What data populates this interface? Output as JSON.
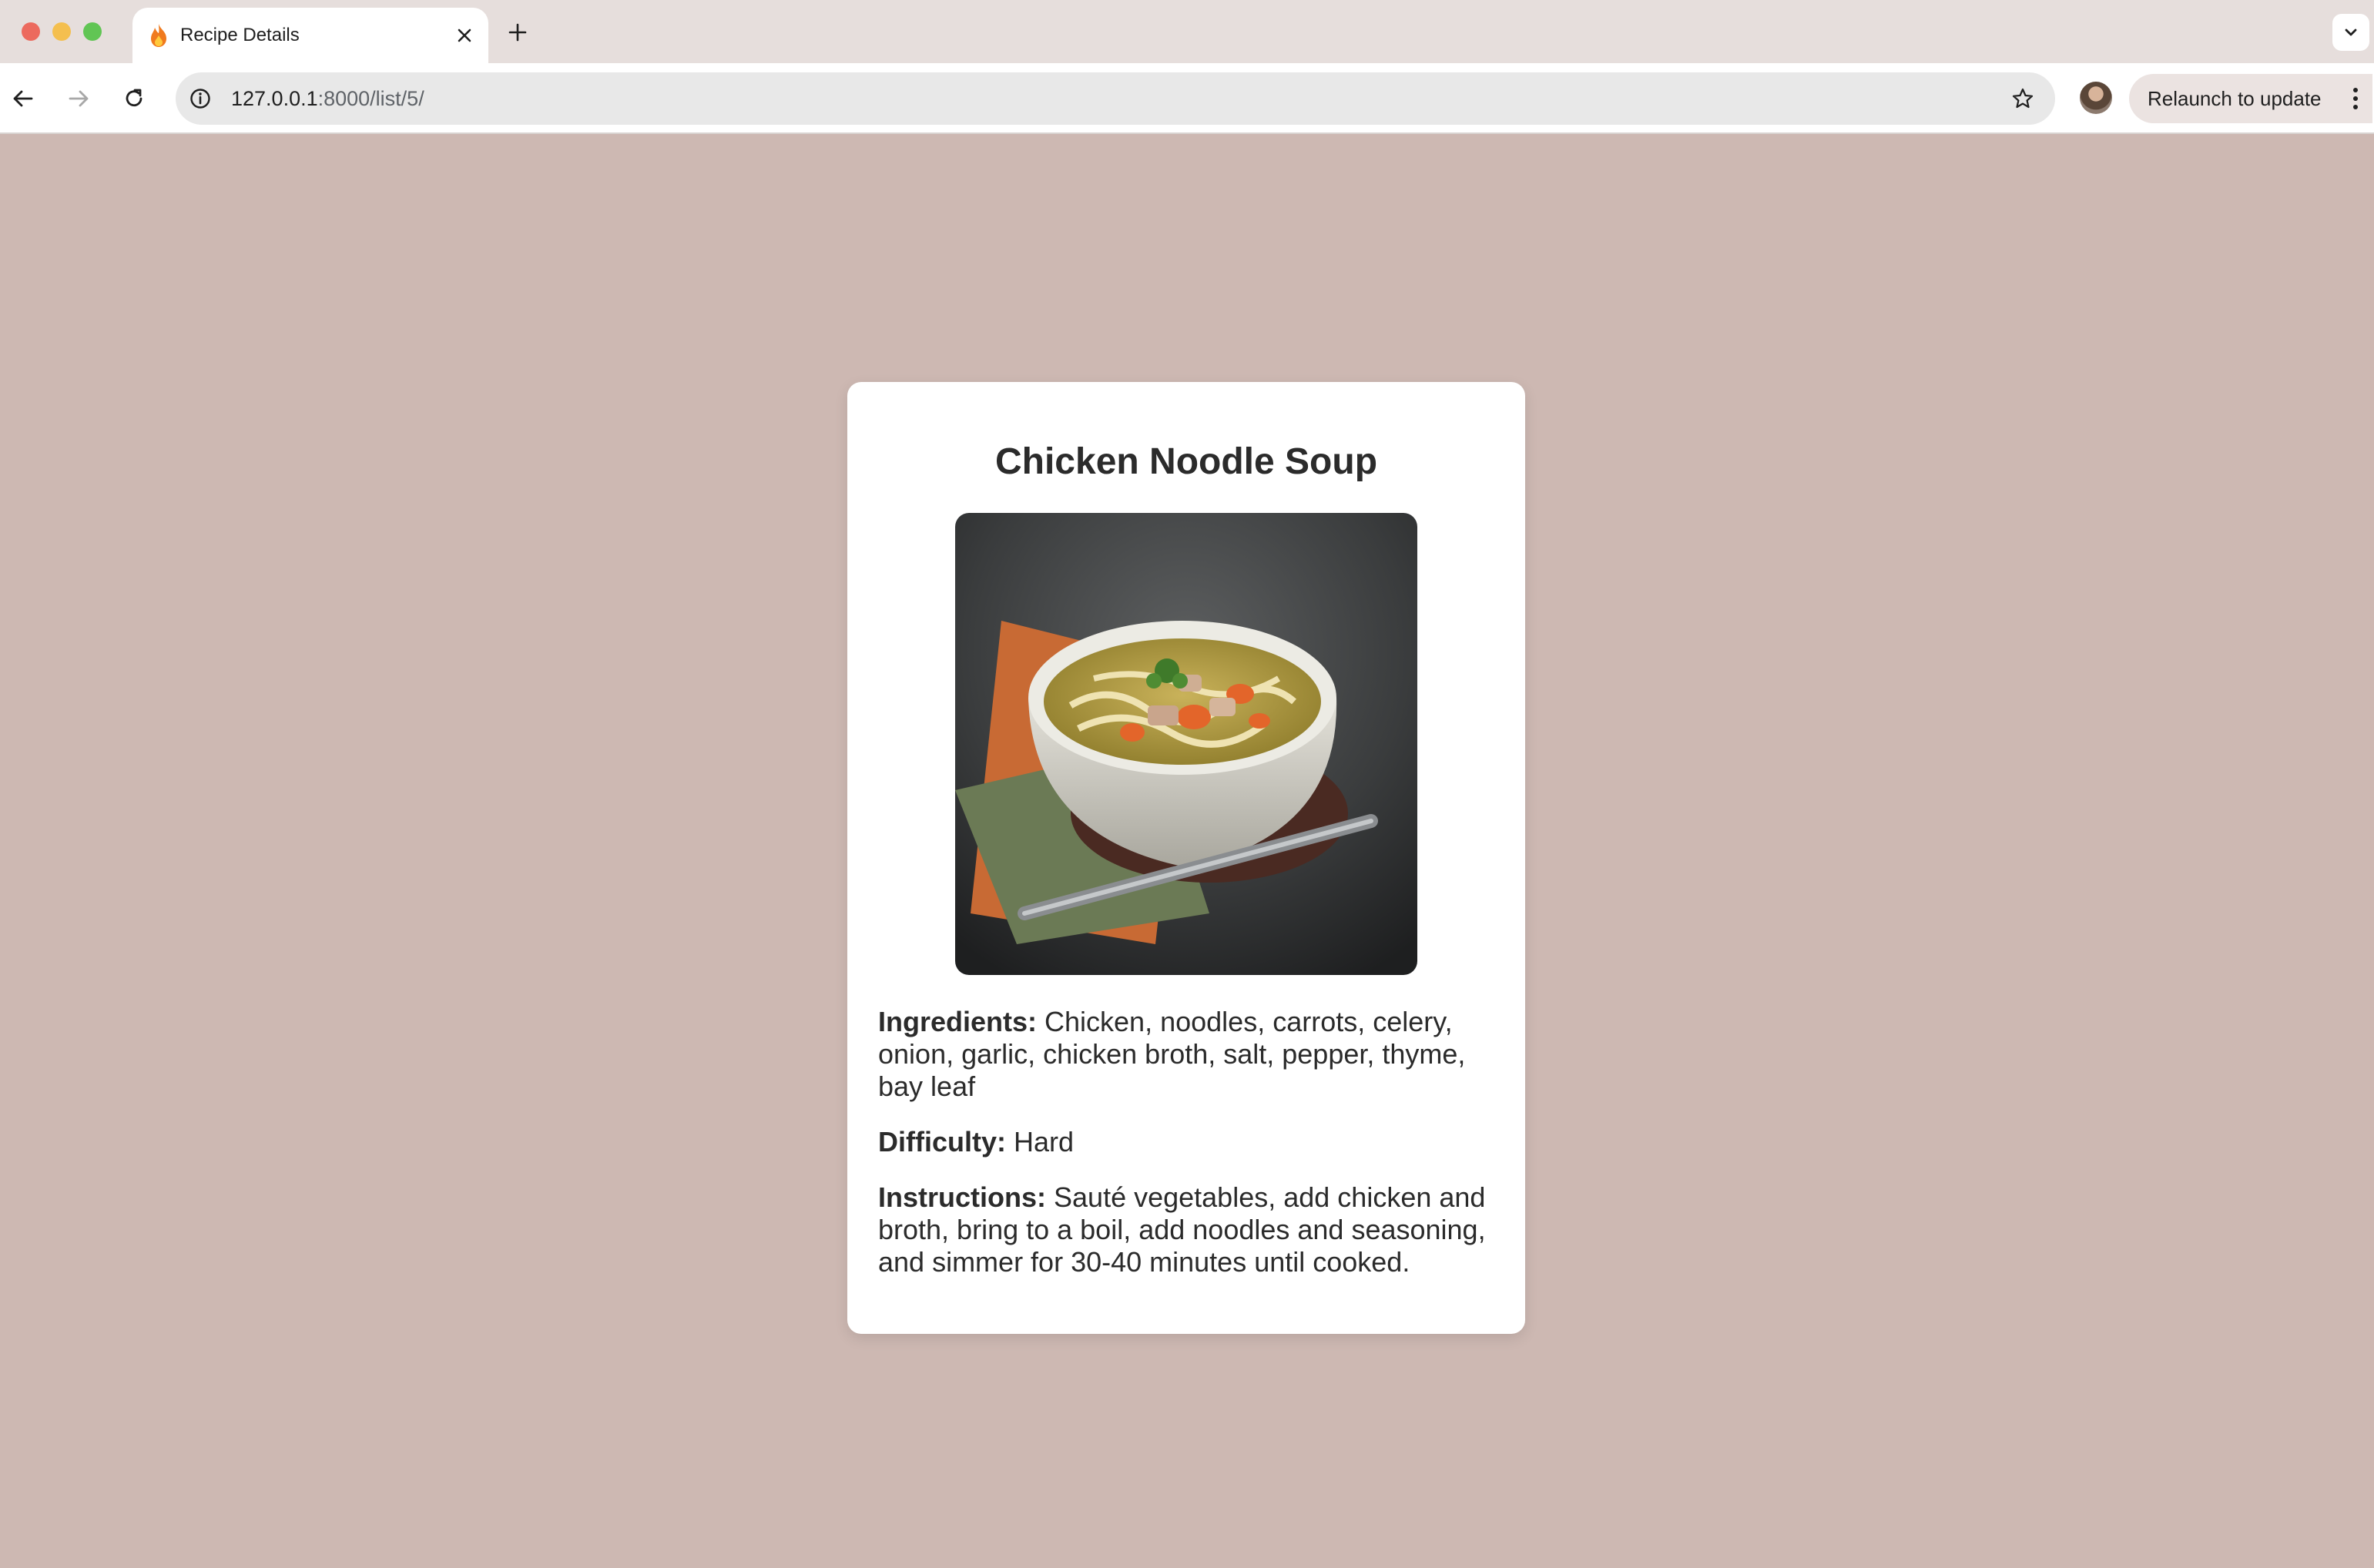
{
  "browser": {
    "tab": {
      "title": "Recipe Details",
      "favicon": "fire-icon"
    },
    "address_bar": {
      "host": "127.0.0.1",
      "path": ":8000/list/5/"
    },
    "relaunch_label": "Relaunch to update",
    "colors": {
      "tabstrip": "#e6dedc",
      "omnibox": "#e8e8e8"
    }
  },
  "page": {
    "background": "#cdb8b2",
    "recipe": {
      "title": "Chicken Noodle Soup",
      "image_alt": "Bowl of chicken noodle soup",
      "ingredients_label": "Ingredients:",
      "ingredients": " Chicken, noodles, carrots, celery, onion, garlic, chicken broth, salt, pepper, thyme, bay leaf",
      "difficulty_label": "Difficulty:",
      "difficulty": " Hard",
      "instructions_label": "Instructions:",
      "instructions": " Sauté vegetables, add chicken and broth, bring to a boil, add noodles and seasoning, and simmer for 30-40 minutes until cooked."
    }
  }
}
